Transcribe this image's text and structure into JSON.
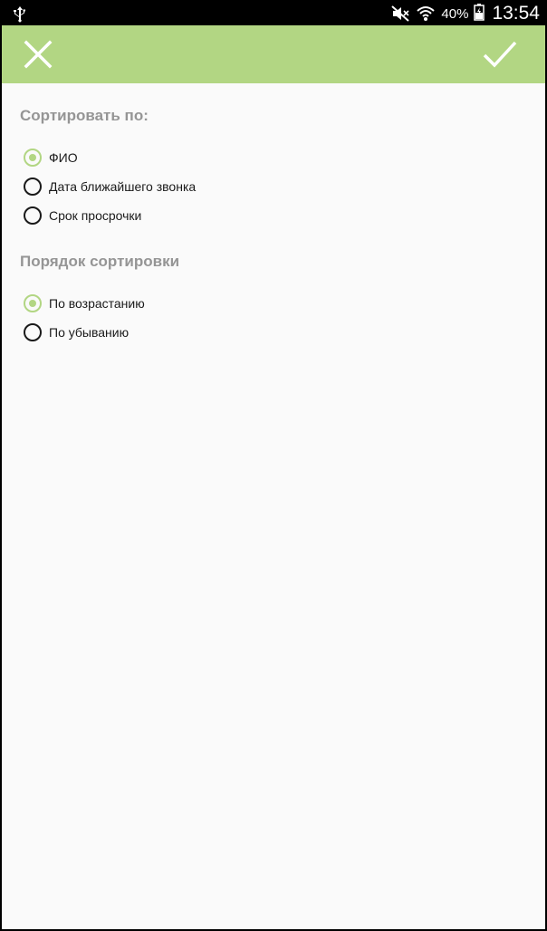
{
  "status_bar": {
    "left_icon": "usb-icon",
    "icons": [
      "mute-icon",
      "wifi-icon",
      "battery-icon"
    ],
    "battery_percent": "40%",
    "time": "13:54"
  },
  "toolbar": {
    "background_color": "#b2d683",
    "close_icon": "close-icon",
    "confirm_icon": "checkmark-icon"
  },
  "sort_by": {
    "title": "Сортировать по:",
    "options": [
      {
        "label": "ФИО",
        "checked": true
      },
      {
        "label": "Дата ближайшего звонка",
        "checked": false
      },
      {
        "label": "Срок просрочки",
        "checked": false
      }
    ]
  },
  "sort_order": {
    "title": "Порядок сортировки",
    "options": [
      {
        "label": "По возрастанию",
        "checked": true
      },
      {
        "label": "По убыванию",
        "checked": false
      }
    ]
  },
  "colors": {
    "accent": "#b2d683",
    "section_title": "#959595"
  }
}
